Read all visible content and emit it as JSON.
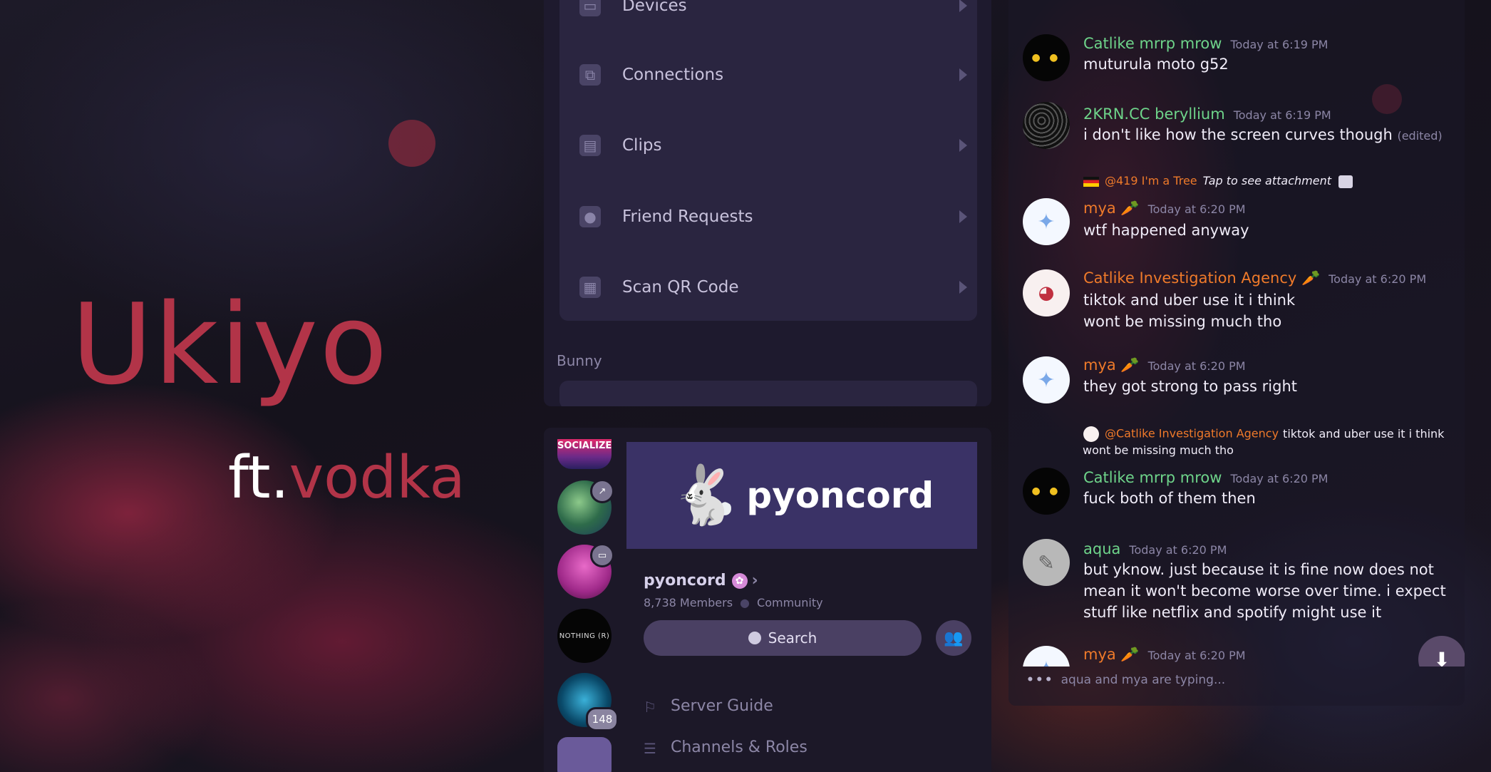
{
  "hero": {
    "title": "Ukiyo",
    "subtitle_ft": "ft.",
    "subtitle_name": "vodka"
  },
  "settings": {
    "items": [
      {
        "label": "Devices",
        "icon": "devices-icon"
      },
      {
        "label": "Connections",
        "icon": "connections-icon"
      },
      {
        "label": "Clips",
        "icon": "clips-icon"
      },
      {
        "label": "Friend Requests",
        "icon": "friend-requests-icon"
      },
      {
        "label": "Scan QR Code",
        "icon": "qr-code-icon"
      }
    ],
    "section_label": "Bunny"
  },
  "server": {
    "guild_1_label": "SOCIALIZE",
    "guild_4_label": "NOTHING (R)",
    "mention_count": "148",
    "banner_name": "pyoncord",
    "name": "pyoncord",
    "members": "8,738 Members",
    "type": "Community",
    "search_label": "Search",
    "nav": [
      {
        "label": "Server Guide"
      },
      {
        "label": "Channels & Roles"
      }
    ]
  },
  "chat": {
    "messages": [
      {
        "author": "Catlike mrrp mrow",
        "time": "Today at 6:19 PM",
        "lines": [
          "muturula moto g52"
        ]
      },
      {
        "author": "2KRN.CC beryllium",
        "time": "Today at 6:19 PM",
        "lines": [
          "i don't like how the screen curves though"
        ],
        "edited": "(edited)"
      },
      {
        "reply_to": "@419 I'm a Tree",
        "reply_text": "Tap to see attachment",
        "author": "mya 🥕",
        "time": "Today at 6:20 PM",
        "lines": [
          "wtf happened anyway"
        ]
      },
      {
        "author": "Catlike Investigation Agency 🥕",
        "time": "Today at 6:20 PM",
        "lines": [
          "tiktok and uber use it i think",
          "wont be missing much tho"
        ]
      },
      {
        "author": "mya 🥕",
        "time": "Today at 6:20 PM",
        "lines": [
          "they got strong to pass right"
        ]
      },
      {
        "reply_to": "@Catlike Investigation Agency",
        "reply_text": "tiktok and uber use it i think",
        "reply_text_2": "wont be missing much tho",
        "author": "Catlike mrrp mrow",
        "time": "Today at 6:20 PM",
        "lines": [
          "fuck both of them then"
        ]
      },
      {
        "author": "aqua",
        "time": "Today at 6:20 PM",
        "lines": [
          "but yknow. just because it is fine now does not",
          "mean it won't become worse over time. i expect",
          "stuff like netflix and spotify might use it"
        ]
      },
      {
        "author": "mya 🥕",
        "time": "Today at 6:20 PM",
        "lines": []
      }
    ],
    "typing": "aqua and mya are typing..."
  },
  "colors": {
    "accent": "#b23448",
    "role_green": "#6ed48a",
    "role_orange": "#ef7a2a"
  }
}
